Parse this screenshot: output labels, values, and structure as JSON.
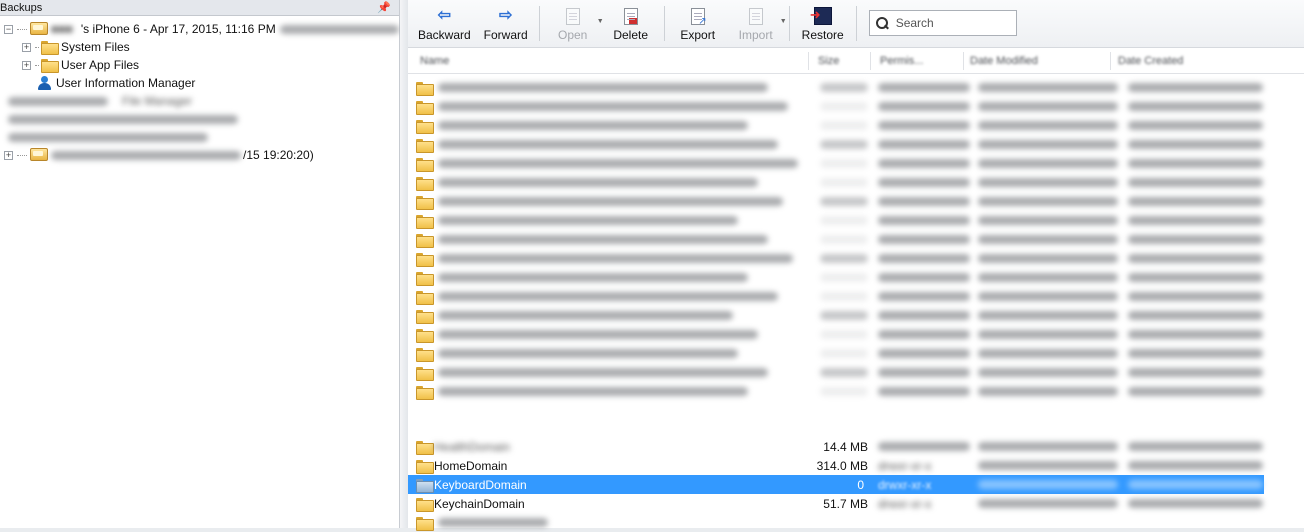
{
  "left_panel": {
    "title": "Backups",
    "pin_icon": "pin-icon",
    "tree": {
      "device_label": "'s iPhone 6 - Apr 17, 2015, 11:16 PM",
      "children": [
        {
          "label": "System Files",
          "icon": "folder-icon"
        },
        {
          "label": "User App Files",
          "icon": "folder-icon"
        },
        {
          "label": "User Information Manager",
          "icon": "user-icon"
        }
      ],
      "blurred_manager_label": "File Manager",
      "second_device_tail": "/15 19:20:20)"
    }
  },
  "toolbar": {
    "backward": "Backward",
    "forward": "Forward",
    "open": "Open",
    "delete": "Delete",
    "export": "Export",
    "import": "Import",
    "restore": "Restore",
    "search_placeholder": "Search"
  },
  "list": {
    "columns": [
      "Name",
      "Size",
      "Permis...",
      "Date Modified",
      "Date Created"
    ],
    "visible_rows": [
      {
        "name": "HealthDomain",
        "size": "14.4 MB",
        "blurred": true
      },
      {
        "name": "HomeDomain",
        "size": "314.0 MB",
        "perms": "drwxr-xr-x",
        "blurred": false
      },
      {
        "name": "KeyboardDomain",
        "size": "0",
        "perms": "drwxr-xr-x",
        "selected": true
      },
      {
        "name": "KeychainDomain",
        "size": "51.7 MB",
        "perms": "drwxr-xr-x"
      }
    ]
  },
  "colors": {
    "selection": "#3399ff",
    "accent_arrow": "#2d6fd4",
    "folder_yellow": "#f0c048"
  }
}
